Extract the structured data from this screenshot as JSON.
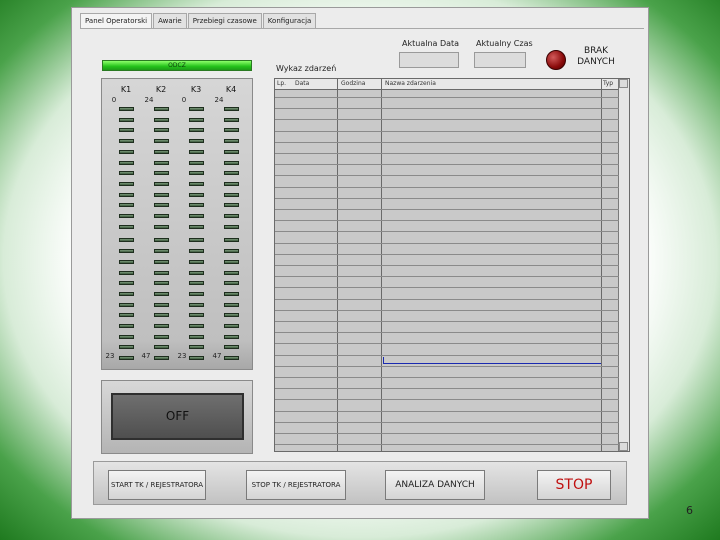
{
  "tabs": [
    "Panel Operatorski",
    "Awarie",
    "Przebiegi czasowe",
    "Konfiguracja"
  ],
  "green_bar_text": "ODCZ",
  "channels": {
    "headers": [
      "K1",
      "K2",
      "K3",
      "K4"
    ],
    "top_numbers": [
      "0",
      "24",
      "0",
      "24"
    ],
    "bottom_numbers": [
      "23",
      "47",
      "23",
      "47"
    ]
  },
  "off_button": "OFF",
  "wykaz_label": "Wykaz zdarzeń",
  "date_label": "Aktualna Data",
  "time_label": "Aktualny Czas",
  "status_text": "BRAK DANYCH",
  "table": {
    "columns": [
      "Lp.",
      "Data",
      "Godzina",
      "Nazwa zdarzenia",
      "Typ"
    ]
  },
  "buttons": {
    "start_reg": "START TK / REJESTRATORA",
    "stop_reg": "STOP TK / REJESTRATORA",
    "analysis": "ANALIZA DANYCH",
    "stop": "STOP"
  },
  "page_number": "6",
  "colors": {
    "accent_green": "#23c21a",
    "lamp_red": "#8a0a0a",
    "stop_red": "#c01010",
    "table_bg": "#c9c9c9"
  }
}
